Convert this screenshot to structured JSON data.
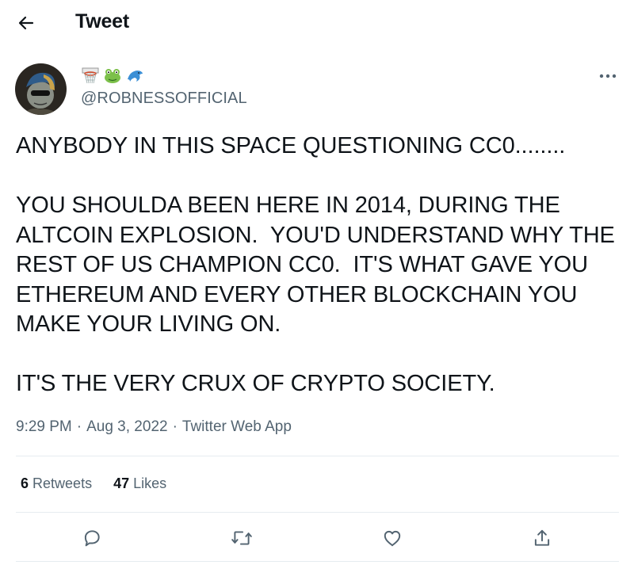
{
  "header": {
    "title": "Tweet",
    "back_icon": "arrow-left-icon"
  },
  "author": {
    "display_name_emojis": [
      "basketball-hoop-emoji",
      "frog-emoji",
      "dolphin-emoji"
    ],
    "handle": "@ROBNESSOFFICIAL"
  },
  "tweet": {
    "text": "ANYBODY IN THIS SPACE QUESTIONING CC0........\n\nYOU SHOULDA BEEN HERE IN 2014, DURING THE ALTCOIN EXPLOSION.  YOU'D UNDERSTAND WHY THE REST OF US CHAMPION CC0.  IT'S WHAT GAVE YOU ETHEREUM AND EVERY OTHER BLOCKCHAIN YOU MAKE YOUR LIVING ON.\n\nIT'S THE VERY CRUX OF CRYPTO SOCIETY.",
    "time": "9:29 PM",
    "separator": "·",
    "date": "Aug 3, 2022",
    "source": "Twitter Web App"
  },
  "stats": {
    "retweets_count": "6",
    "retweets_label": "Retweets",
    "likes_count": "47",
    "likes_label": "Likes"
  },
  "actions": [
    "reply-icon",
    "retweet-icon",
    "like-icon",
    "share-icon"
  ],
  "colors": {
    "text": "#0f1419",
    "secondary": "#536471",
    "divider": "#e6ecf0"
  }
}
